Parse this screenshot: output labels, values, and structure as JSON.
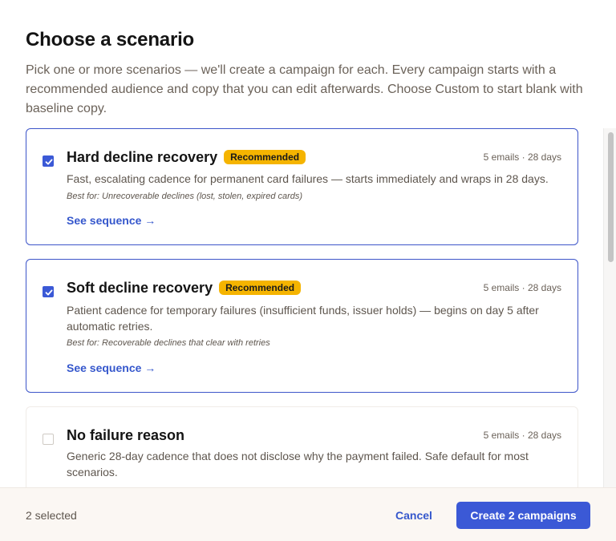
{
  "header": {
    "title": "Choose a scenario",
    "subtitle": "Pick one or more scenarios — we'll create a campaign for each. Every campaign starts with a recommended audience and copy that you can edit afterwards. Choose Custom to start blank with baseline copy."
  },
  "scenarios": [
    {
      "title": "Hard decline recovery",
      "badge": "Recommended",
      "meta": "5 emails · 28 days",
      "description": "Fast, escalating cadence for permanent card failures — starts immediately and wraps in 28 days.",
      "best_for": "Best for: Unrecoverable declines (lost, stolen, expired cards)",
      "link": "See sequence →",
      "checked": true
    },
    {
      "title": "Soft decline recovery",
      "badge": "Recommended",
      "meta": "5 emails · 28 days",
      "description": "Patient cadence for temporary failures (insufficient funds, issuer holds) — begins on day 5 after automatic retries.",
      "best_for": "Best for: Recoverable declines that clear with retries",
      "link": "See sequence →",
      "checked": true
    },
    {
      "title": "No failure reason",
      "meta": "5 emails · 28 days",
      "description": "Generic 28-day cadence that does not disclose why the payment failed. Safe default for most scenarios.",
      "checked": false
    }
  ],
  "footer": {
    "selected_count": "2 selected",
    "cancel_label": "Cancel",
    "create_label": "Create 2 campaigns"
  },
  "colors": {
    "accent": "#3b59d6",
    "badge": "#f5b400",
    "footer_bg": "#fbf7f3"
  }
}
